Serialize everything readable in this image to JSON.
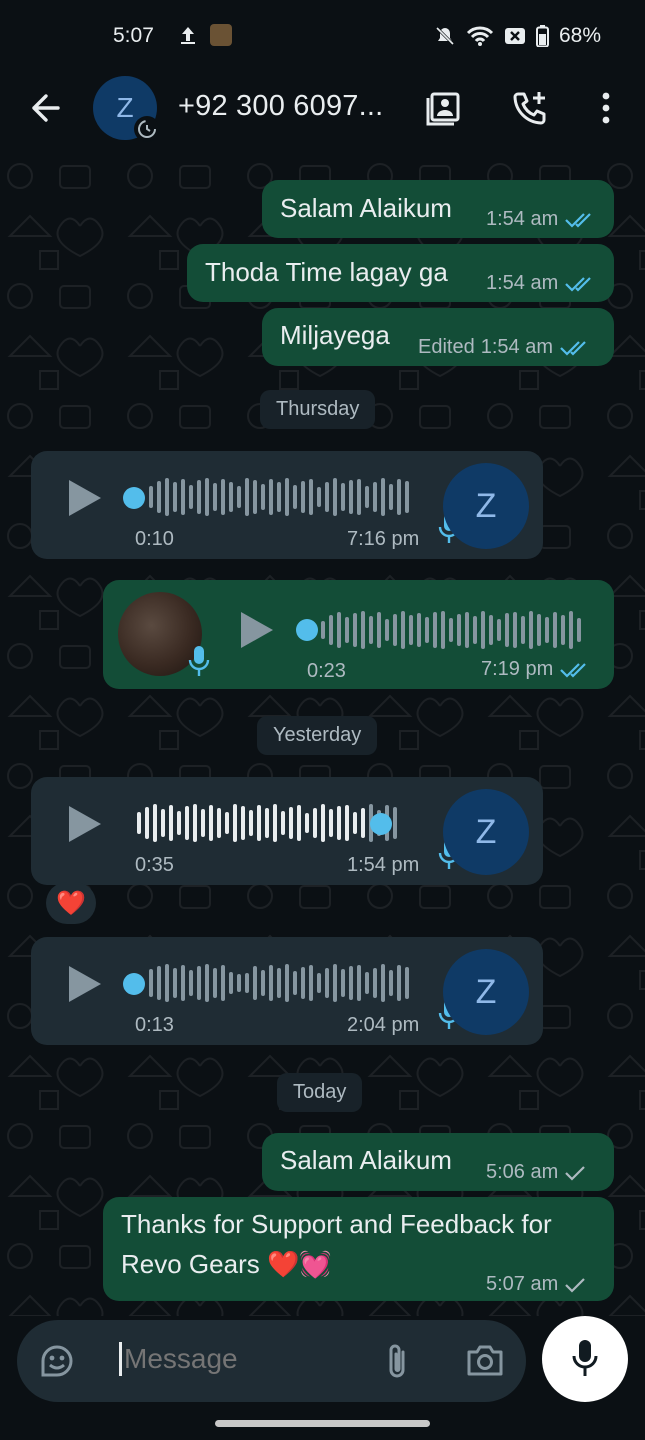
{
  "status_bar": {
    "time": "5:07",
    "battery": "68%"
  },
  "header": {
    "avatar_letter": "Z",
    "contact_name": "+92 300 6097..."
  },
  "messages": [
    {
      "text": "Salam Alaikum",
      "time": "1:54 am"
    },
    {
      "text": "Thoda Time lagay ga",
      "time": "1:54 am"
    },
    {
      "text": "Miljayega",
      "edited": "Edited",
      "time": "1:54 am"
    },
    {
      "text": "Salam Alaikum",
      "time": "5:06 am"
    },
    {
      "text_line1": "Thanks for Support and Feedback for",
      "text_line2": "Revo Gears ❤️💓",
      "time": "5:07 am"
    }
  ],
  "dates": {
    "d1": "Thursday",
    "d2": "Yesterday",
    "d3": "Today"
  },
  "voice": [
    {
      "duration": "0:10",
      "time": "7:16 pm",
      "avatar": "Z"
    },
    {
      "duration": "0:23",
      "time": "7:19 pm"
    },
    {
      "duration": "0:35",
      "time": "1:54 pm",
      "avatar": "Z",
      "reaction": "❤️"
    },
    {
      "duration": "0:13",
      "time": "2:04 pm",
      "avatar": "Z"
    }
  ],
  "composer": {
    "placeholder": "Message"
  },
  "colors": {
    "outgoing_bubble": "#134d37",
    "incoming_bubble": "#1f2c34",
    "read_tick": "#53bdeb",
    "background": "#0b1014"
  },
  "icons": [
    "arrow-left-icon",
    "contacts-icon",
    "add-call-icon",
    "more-vert-icon",
    "sticker-icon",
    "attach-icon",
    "camera-icon",
    "mic-icon",
    "play-icon",
    "double-tick-icon",
    "single-tick-icon"
  ]
}
